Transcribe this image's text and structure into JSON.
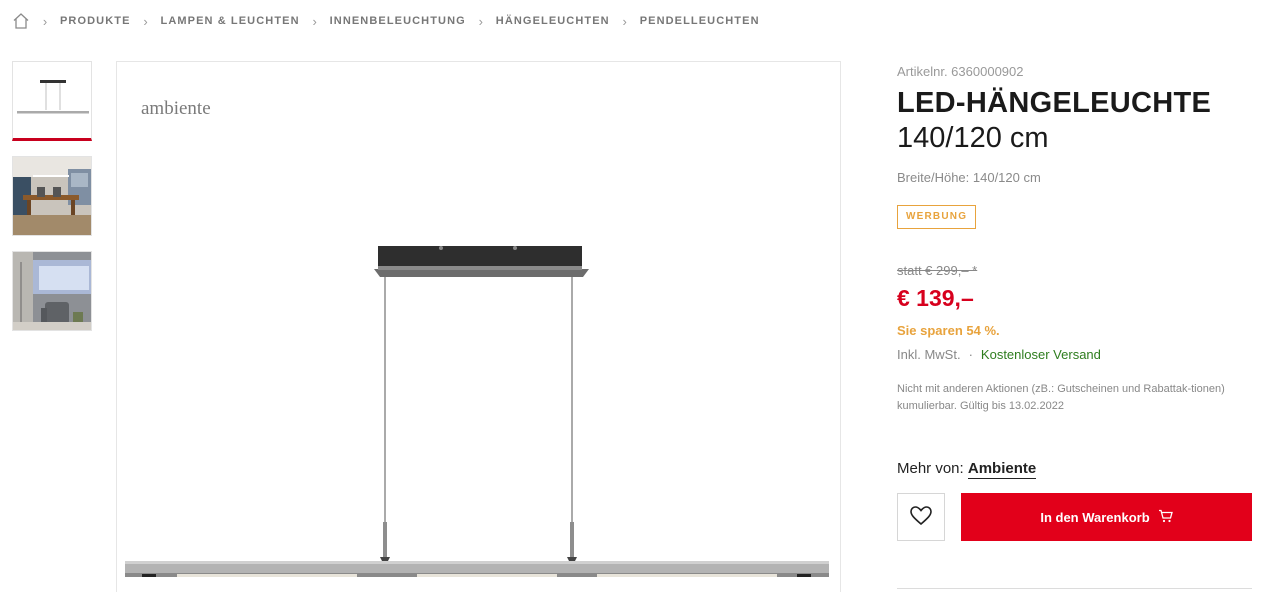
{
  "breadcrumb": {
    "home_icon": "home-icon",
    "items": [
      "PRODUKTE",
      "LAMPEN & LEUCHTEN",
      "INNENBELEUCHTUNG",
      "HÄNGELEUCHTEN",
      "PENDELLEUCHTEN"
    ]
  },
  "gallery": {
    "thumbnails": [
      "lamp-product-thumbnail",
      "dining-room-thumbnail",
      "living-room-thumbnail"
    ],
    "active_index": 0
  },
  "main_image": {
    "brand_logo": "ambiente"
  },
  "product": {
    "article_nr": "Artikelnr. 6360000902",
    "title": "LED-HÄNGELEUCHTE",
    "subtitle": "140/120 cm",
    "dimensions": "Breite/Höhe: 140/120 cm",
    "ad_badge": "WERBUNG",
    "old_price": "statt € 299,– *",
    "price": "€ 139,–",
    "savings": "Sie sparen 54 %.",
    "tax": "Inkl. MwSt.",
    "separator": "·",
    "shipping": "Kostenloser Versand",
    "notice": "Nicht mit anderen Aktionen (zB.: Gutscheinen und Rabattak-tionen) kumulierbar. Gültig bis 13.02.2022",
    "more_from_label": "Mehr von:",
    "more_from_brand": "Ambiente"
  },
  "actions": {
    "wishlist_icon": "heart-icon",
    "cart_label": "In den Warenkorb",
    "cart_icon": "cart-icon"
  },
  "colors": {
    "accent_red": "#e2001a",
    "price_red": "#d7001d",
    "badge_orange": "#e8a33d",
    "shipping_green": "#2e7d1e"
  }
}
